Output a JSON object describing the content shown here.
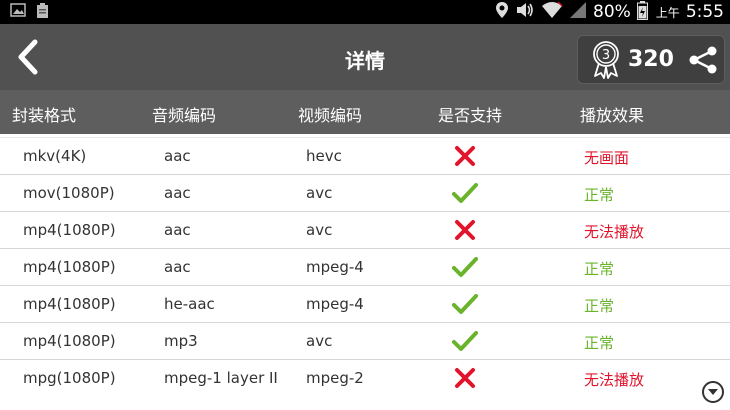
{
  "status_bar": {
    "battery_percent": "80%",
    "clock_prefix": "上午",
    "clock": "5:55",
    "icons": [
      "image-icon",
      "clipboard-icon",
      "location-icon",
      "volume-icon",
      "wifi-icon",
      "signal-icon",
      "battery-icon"
    ]
  },
  "app_bar": {
    "title": "详情",
    "badge_count": "320",
    "badge_level": "3"
  },
  "table": {
    "headers": [
      "封装格式",
      "音频编码",
      "视频编码",
      "是否支持",
      "播放效果"
    ],
    "rows": [
      {
        "container": "mkv(4K)",
        "audio": "aac",
        "video": "hevc",
        "supported": false,
        "effect": "无画面"
      },
      {
        "container": "mov(1080P)",
        "audio": "aac",
        "video": "avc",
        "supported": true,
        "effect": "正常"
      },
      {
        "container": "mp4(1080P)",
        "audio": "aac",
        "video": "avc",
        "supported": false,
        "effect": "无法播放"
      },
      {
        "container": "mp4(1080P)",
        "audio": "aac",
        "video": "mpeg-4",
        "supported": true,
        "effect": "正常"
      },
      {
        "container": "mp4(1080P)",
        "audio": "he-aac",
        "video": "mpeg-4",
        "supported": true,
        "effect": "正常"
      },
      {
        "container": "mp4(1080P)",
        "audio": "mp3",
        "video": "avc",
        "supported": true,
        "effect": "正常"
      },
      {
        "container": "mpg(1080P)",
        "audio": "mpeg-1 layer II",
        "video": "mpeg-2",
        "supported": false,
        "effect": "无法播放"
      }
    ]
  },
  "colors": {
    "app_bar": "#515151",
    "header_row": "#5e5e5e",
    "unsupported": "#e2142b",
    "supported": "#6ab42c"
  }
}
